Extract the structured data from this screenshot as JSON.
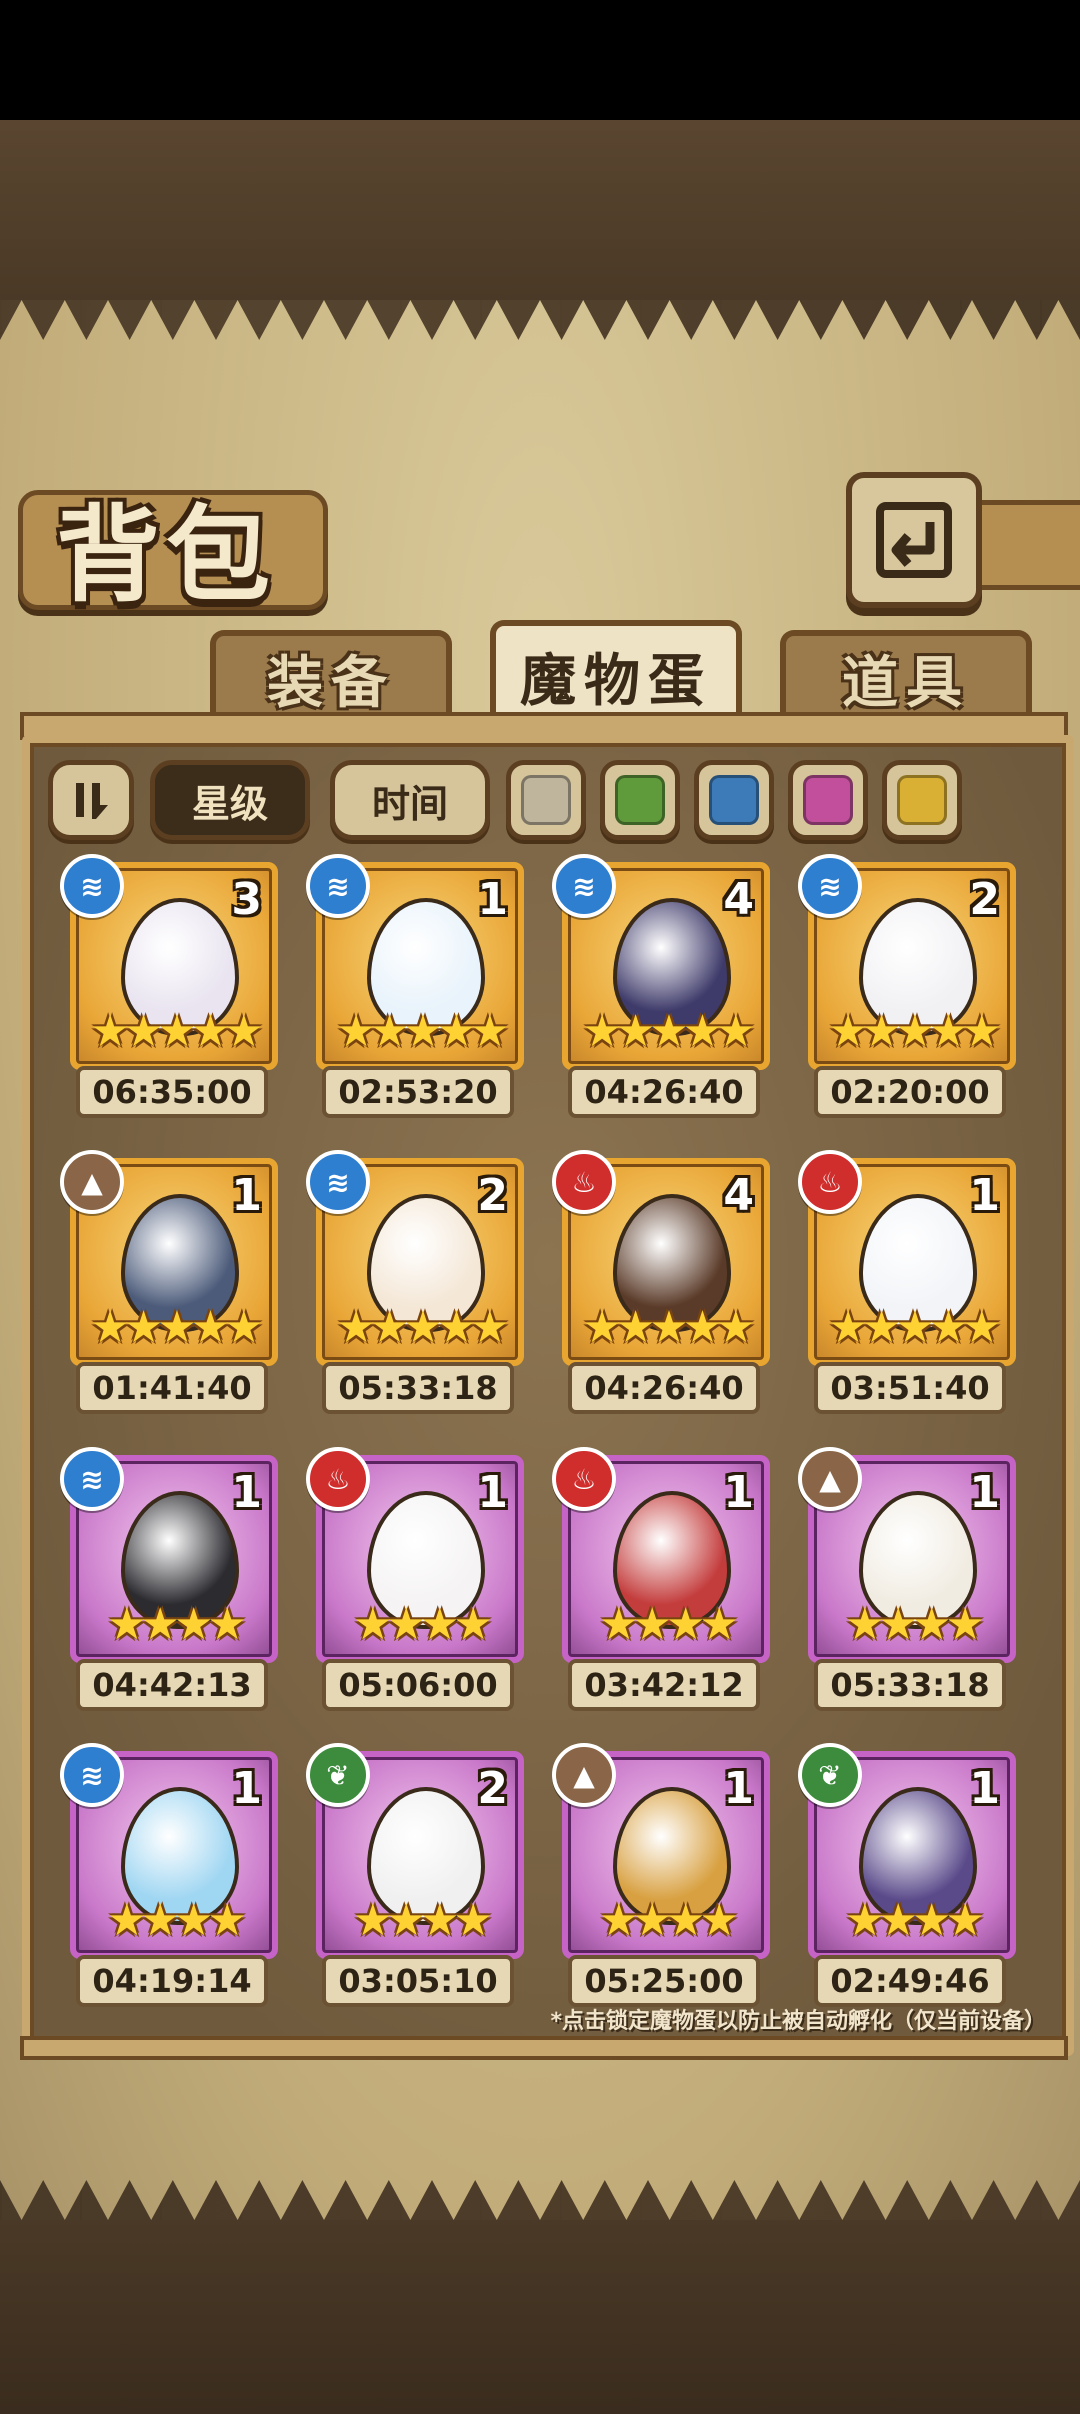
{
  "header": {
    "title": "背包"
  },
  "tabs": [
    {
      "label": "装备",
      "active": false
    },
    {
      "label": "魔物蛋",
      "active": true
    },
    {
      "label": "道具",
      "active": false
    }
  ],
  "filters": {
    "sort_star_label": "星级",
    "sort_time_label": "时间",
    "colors": [
      "#bfb49c",
      "#5f9a3b",
      "#3d7bb8",
      "#c24f9b",
      "#d9b034"
    ]
  },
  "eggs": [
    {
      "count": "3",
      "stars": "★★★★★",
      "time": "06:35:00",
      "element": "water",
      "rarity": "gold",
      "egg_color": "#e9e4f0"
    },
    {
      "count": "1",
      "stars": "★★★★★",
      "time": "02:53:20",
      "element": "water",
      "rarity": "gold",
      "egg_color": "#e8f3fb"
    },
    {
      "count": "4",
      "stars": "★★★★★",
      "time": "04:26:40",
      "element": "water",
      "rarity": "gold",
      "egg_color": "#3e3a6a"
    },
    {
      "count": "2",
      "stars": "★★★★★",
      "time": "02:20:00",
      "element": "water",
      "rarity": "gold",
      "egg_color": "#f1f1f4"
    },
    {
      "count": "1",
      "stars": "★★★★★",
      "time": "01:41:40",
      "element": "earth",
      "rarity": "gold",
      "egg_color": "#4c5b7a"
    },
    {
      "count": "2",
      "stars": "★★★★★",
      "time": "05:33:18",
      "element": "water",
      "rarity": "gold",
      "egg_color": "#f4e7d6"
    },
    {
      "count": "4",
      "stars": "★★★★★",
      "time": "04:26:40",
      "element": "fire",
      "rarity": "gold",
      "egg_color": "#5a3a28"
    },
    {
      "count": "1",
      "stars": "★★★★★",
      "time": "03:51:40",
      "element": "fire",
      "rarity": "gold",
      "egg_color": "#f2f4f8"
    },
    {
      "count": "1",
      "stars": "★★★★",
      "time": "04:42:13",
      "element": "water",
      "rarity": "purple",
      "egg_color": "#2b2b30"
    },
    {
      "count": "1",
      "stars": "★★★★",
      "time": "05:06:00",
      "element": "fire",
      "rarity": "purple",
      "egg_color": "#f5f3f3"
    },
    {
      "count": "1",
      "stars": "★★★★",
      "time": "03:42:12",
      "element": "fire",
      "rarity": "purple",
      "egg_color": "#c43d3d"
    },
    {
      "count": "1",
      "stars": "★★★★",
      "time": "05:33:18",
      "element": "earth",
      "rarity": "purple",
      "egg_color": "#f1ece2"
    },
    {
      "count": "1",
      "stars": "★★★★",
      "time": "04:19:14",
      "element": "water",
      "rarity": "purple",
      "egg_color": "#9fd6f2"
    },
    {
      "count": "2",
      "stars": "★★★★",
      "time": "03:05:10",
      "element": "leaf",
      "rarity": "purple",
      "egg_color": "#f0f0f0"
    },
    {
      "count": "1",
      "stars": "★★★★",
      "time": "05:25:00",
      "element": "earth",
      "rarity": "purple",
      "egg_color": "#d8a040"
    },
    {
      "count": "1",
      "stars": "★★★★",
      "time": "02:49:46",
      "element": "leaf",
      "rarity": "purple",
      "egg_color": "#5a4a8a"
    }
  ],
  "footnote": "*点击锁定魔物蛋以防止被自动孵化（仅当前设备）"
}
